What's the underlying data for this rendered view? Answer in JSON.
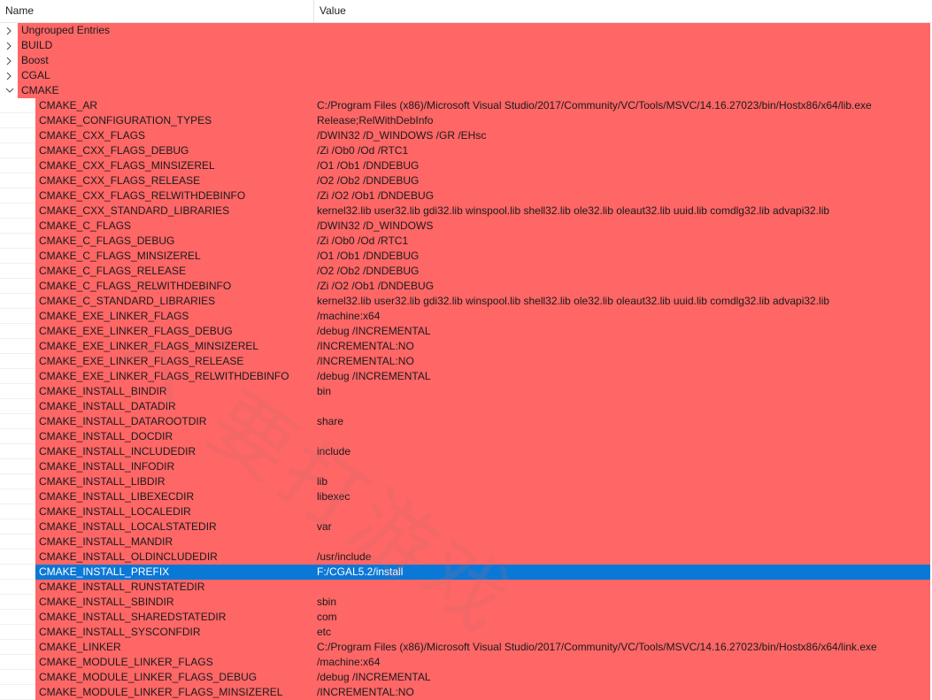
{
  "header": {
    "name_label": "Name",
    "value_label": "Value"
  },
  "groups": [
    {
      "label": "Ungrouped Entries",
      "expanded": false
    },
    {
      "label": "BUILD",
      "expanded": false
    },
    {
      "label": "Boost",
      "expanded": false
    },
    {
      "label": "CGAL",
      "expanded": false
    },
    {
      "label": "CMAKE",
      "expanded": true
    }
  ],
  "entries": [
    {
      "name": "CMAKE_AR",
      "value": "C:/Program Files (x86)/Microsoft Visual Studio/2017/Community/VC/Tools/MSVC/14.16.27023/bin/Hostx86/x64/lib.exe"
    },
    {
      "name": "CMAKE_CONFIGURATION_TYPES",
      "value": "Release;RelWithDebInfo"
    },
    {
      "name": "CMAKE_CXX_FLAGS",
      "value": "/DWIN32 /D_WINDOWS /GR /EHsc"
    },
    {
      "name": "CMAKE_CXX_FLAGS_DEBUG",
      "value": "/Zi /Ob0 /Od /RTC1"
    },
    {
      "name": "CMAKE_CXX_FLAGS_MINSIZEREL",
      "value": "/O1 /Ob1 /DNDEBUG"
    },
    {
      "name": "CMAKE_CXX_FLAGS_RELEASE",
      "value": "/O2 /Ob2 /DNDEBUG"
    },
    {
      "name": "CMAKE_CXX_FLAGS_RELWITHDEBINFO",
      "value": "/Zi /O2 /Ob1 /DNDEBUG"
    },
    {
      "name": "CMAKE_CXX_STANDARD_LIBRARIES",
      "value": "kernel32.lib user32.lib gdi32.lib winspool.lib shell32.lib ole32.lib oleaut32.lib uuid.lib comdlg32.lib advapi32.lib"
    },
    {
      "name": "CMAKE_C_FLAGS",
      "value": "/DWIN32 /D_WINDOWS"
    },
    {
      "name": "CMAKE_C_FLAGS_DEBUG",
      "value": "/Zi /Ob0 /Od /RTC1"
    },
    {
      "name": "CMAKE_C_FLAGS_MINSIZEREL",
      "value": "/O1 /Ob1 /DNDEBUG"
    },
    {
      "name": "CMAKE_C_FLAGS_RELEASE",
      "value": "/O2 /Ob2 /DNDEBUG"
    },
    {
      "name": "CMAKE_C_FLAGS_RELWITHDEBINFO",
      "value": "/Zi /O2 /Ob1 /DNDEBUG"
    },
    {
      "name": "CMAKE_C_STANDARD_LIBRARIES",
      "value": "kernel32.lib user32.lib gdi32.lib winspool.lib shell32.lib ole32.lib oleaut32.lib uuid.lib comdlg32.lib advapi32.lib"
    },
    {
      "name": "CMAKE_EXE_LINKER_FLAGS",
      "value": "/machine:x64"
    },
    {
      "name": "CMAKE_EXE_LINKER_FLAGS_DEBUG",
      "value": "/debug /INCREMENTAL"
    },
    {
      "name": "CMAKE_EXE_LINKER_FLAGS_MINSIZEREL",
      "value": "/INCREMENTAL:NO"
    },
    {
      "name": "CMAKE_EXE_LINKER_FLAGS_RELEASE",
      "value": "/INCREMENTAL:NO"
    },
    {
      "name": "CMAKE_EXE_LINKER_FLAGS_RELWITHDEBINFO",
      "value": "/debug /INCREMENTAL"
    },
    {
      "name": "CMAKE_INSTALL_BINDIR",
      "value": "bin"
    },
    {
      "name": "CMAKE_INSTALL_DATADIR",
      "value": ""
    },
    {
      "name": "CMAKE_INSTALL_DATAROOTDIR",
      "value": "share"
    },
    {
      "name": "CMAKE_INSTALL_DOCDIR",
      "value": ""
    },
    {
      "name": "CMAKE_INSTALL_INCLUDEDIR",
      "value": "include"
    },
    {
      "name": "CMAKE_INSTALL_INFODIR",
      "value": ""
    },
    {
      "name": "CMAKE_INSTALL_LIBDIR",
      "value": "lib"
    },
    {
      "name": "CMAKE_INSTALL_LIBEXECDIR",
      "value": "libexec"
    },
    {
      "name": "CMAKE_INSTALL_LOCALEDIR",
      "value": ""
    },
    {
      "name": "CMAKE_INSTALL_LOCALSTATEDIR",
      "value": "var"
    },
    {
      "name": "CMAKE_INSTALL_MANDIR",
      "value": ""
    },
    {
      "name": "CMAKE_INSTALL_OLDINCLUDEDIR",
      "value": "/usr/include"
    },
    {
      "name": "CMAKE_INSTALL_PREFIX",
      "value": "F:/CGAL5.2/install",
      "selected": true
    },
    {
      "name": "CMAKE_INSTALL_RUNSTATEDIR",
      "value": ""
    },
    {
      "name": "CMAKE_INSTALL_SBINDIR",
      "value": "sbin"
    },
    {
      "name": "CMAKE_INSTALL_SHAREDSTATEDIR",
      "value": "com"
    },
    {
      "name": "CMAKE_INSTALL_SYSCONFDIR",
      "value": "etc"
    },
    {
      "name": "CMAKE_LINKER",
      "value": "C:/Program Files (x86)/Microsoft Visual Studio/2017/Community/VC/Tools/MSVC/14.16.27023/bin/Hostx86/x64/link.exe"
    },
    {
      "name": "CMAKE_MODULE_LINKER_FLAGS",
      "value": "/machine:x64"
    },
    {
      "name": "CMAKE_MODULE_LINKER_FLAGS_DEBUG",
      "value": "/debug /INCREMENTAL"
    },
    {
      "name": "CMAKE_MODULE_LINKER_FLAGS_MINSIZEREL",
      "value": "/INCREMENTAL:NO"
    }
  ],
  "watermark": {
    "text": "ヘ 要打游戏"
  },
  "colors": {
    "changed_row": "#ff6666",
    "selected_row": "#0a78d7"
  }
}
